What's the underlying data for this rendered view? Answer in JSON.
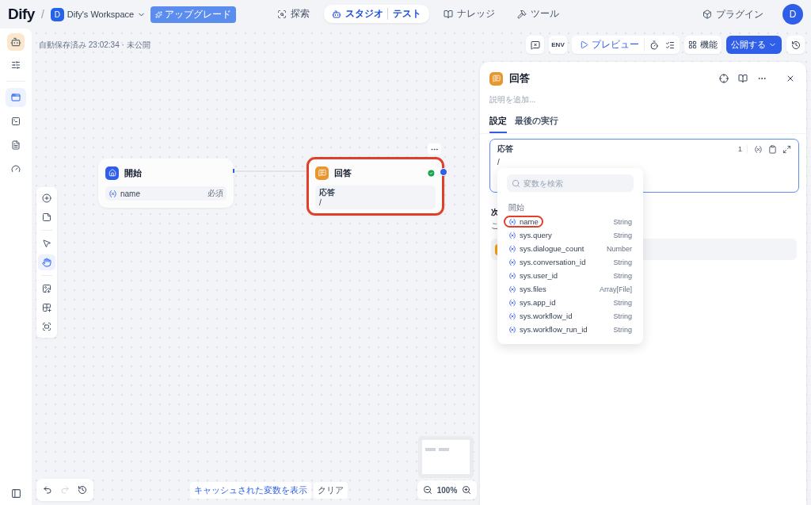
{
  "header": {
    "logo": "Dify",
    "separator": "/",
    "workspace": {
      "initial": "D",
      "name": "Dify's Workspace"
    },
    "upgrade": "アップグレード",
    "nav": [
      {
        "kind": "explore",
        "label": "探索",
        "selected": false
      },
      {
        "kind": "studio",
        "label": "スタジオ",
        "sub": "テスト",
        "selected": true
      },
      {
        "kind": "knowledge",
        "label": "ナレッジ",
        "selected": false
      },
      {
        "kind": "tools",
        "label": "ツール",
        "selected": false
      }
    ],
    "plugin": "プラグイン",
    "avatar": "D"
  },
  "sidebar": {
    "items": [
      {
        "kind": "settings",
        "selected": false
      },
      {
        "kind": "window",
        "selected": true
      },
      {
        "kind": "terminal",
        "selected": false
      },
      {
        "kind": "doc",
        "selected": false
      },
      {
        "kind": "gauge",
        "selected": false
      }
    ]
  },
  "canvas": {
    "autosave": "自動保存済み 23:02:34 · 未公開",
    "env": "ENV",
    "preview": "プレビュー",
    "features": "機能",
    "publish": "公開する",
    "start_node": {
      "title": "開始",
      "variable": "name",
      "required": "必須"
    },
    "answer_node": {
      "title": "回答",
      "field_label": "応答",
      "value": "/",
      "highlighted": true
    },
    "palette": [
      {
        "kind": "add",
        "selected": false
      },
      {
        "kind": "note",
        "selected": false
      },
      {
        "kind": "pointer",
        "selected": false
      },
      {
        "kind": "hand",
        "selected": true
      },
      {
        "kind": "export",
        "selected": false
      },
      {
        "kind": "organize",
        "selected": false
      },
      {
        "kind": "fit",
        "selected": false
      }
    ],
    "cached": "キャッシュされた変数を表示",
    "clear": "クリア",
    "zoom": "100%"
  },
  "panel": {
    "title": "回答",
    "description_placeholder": "説明を追加...",
    "tabs": [
      {
        "label": "設定",
        "selected": true
      },
      {
        "label": "最後の実行",
        "selected": false
      }
    ],
    "editor": {
      "label": "応答",
      "count": "1",
      "value": "/"
    },
    "next_heading": "次",
    "next_desc": "こ",
    "dropdown": {
      "search_placeholder": "変数を検索",
      "group": "開始",
      "items": [
        {
          "name": "name",
          "type": "String",
          "highlighted": true
        },
        {
          "name": "sys.query",
          "type": "String",
          "highlighted": false
        },
        {
          "name": "sys.dialogue_count",
          "type": "Number",
          "highlighted": false
        },
        {
          "name": "sys.conversation_id",
          "type": "String",
          "highlighted": false
        },
        {
          "name": "sys.user_id",
          "type": "String",
          "highlighted": false
        },
        {
          "name": "sys.files",
          "type": "Array[File]",
          "highlighted": false
        },
        {
          "name": "sys.app_id",
          "type": "String",
          "highlighted": false
        },
        {
          "name": "sys.workflow_id",
          "type": "String",
          "highlighted": false
        },
        {
          "name": "sys.workflow_run_id",
          "type": "String",
          "highlighted": false
        }
      ]
    }
  }
}
